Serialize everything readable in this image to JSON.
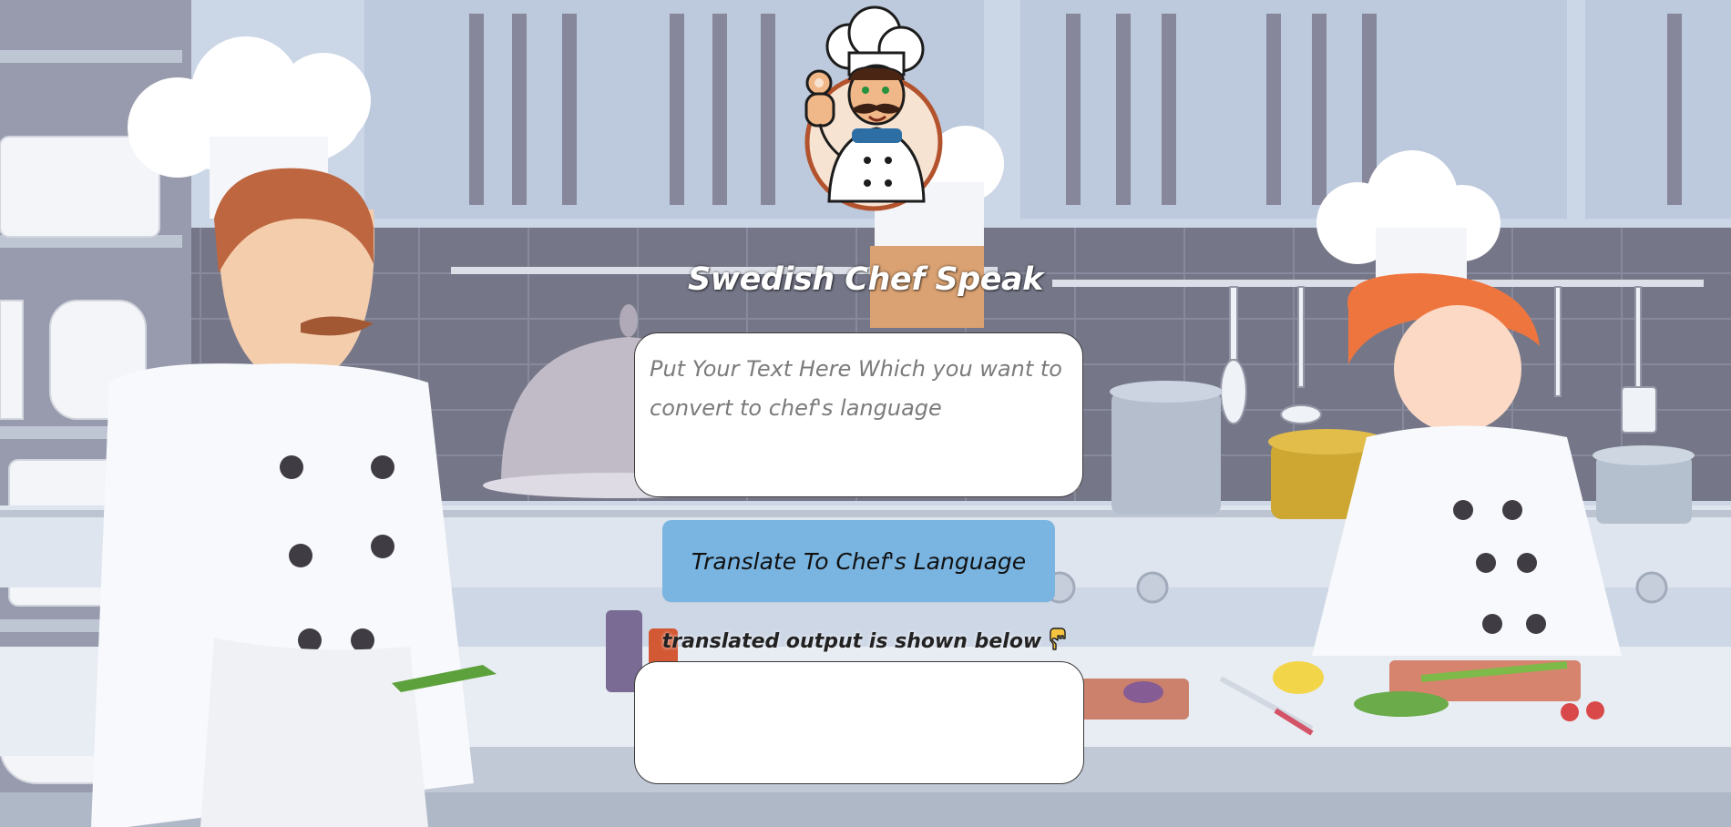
{
  "app": {
    "title": "Swedish Chef Speak"
  },
  "input": {
    "value": "",
    "placeholder": "Put Your Text Here Which you want to convert to chef's language"
  },
  "translate_button": {
    "label": "Translate To Chef's Language"
  },
  "output": {
    "label": "translated output is shown below",
    "label_icon": "pointing-down-hand-icon",
    "value": ""
  },
  "colors": {
    "button": "#7ab5e1",
    "title": "#ffffff",
    "box_border": "#3a3a3a"
  },
  "icons": {
    "logo": "chef-mascot-logo",
    "background": "kitchen-chefs-illustration"
  }
}
